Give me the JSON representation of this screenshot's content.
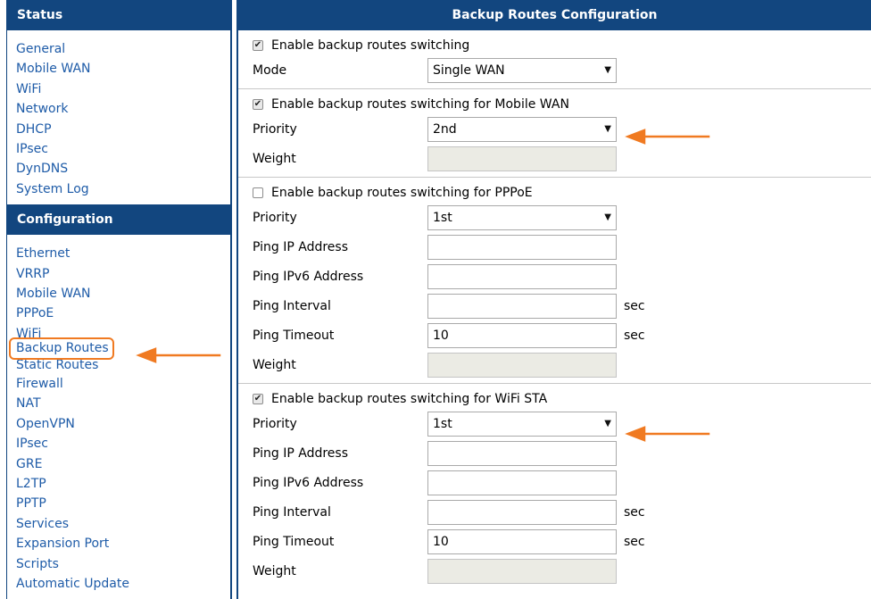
{
  "sidebar": {
    "status_title": "Status",
    "status_items": [
      "General",
      "Mobile WAN",
      "WiFi",
      "Network",
      "DHCP",
      "IPsec",
      "DynDNS",
      "System Log"
    ],
    "config_title": "Configuration",
    "config_items": [
      "Ethernet",
      "VRRP",
      "Mobile WAN",
      "PPPoE",
      "WiFi",
      "Backup Routes",
      "Static Routes",
      "Firewall",
      "NAT",
      "OpenVPN",
      "IPsec",
      "GRE",
      "L2TP",
      "PPTP",
      "Services",
      "Expansion Port",
      "Scripts",
      "Automatic Update"
    ],
    "active_item": "Backup Routes"
  },
  "main": {
    "title": "Backup Routes Configuration",
    "general": {
      "enable_label": "Enable backup routes switching",
      "enable_checked": true,
      "mode_label": "Mode",
      "mode_value": "Single WAN"
    },
    "mobile_wan": {
      "enable_label": "Enable backup routes switching for Mobile WAN",
      "enable_checked": true,
      "priority_label": "Priority",
      "priority_value": "2nd",
      "weight_label": "Weight",
      "weight_value": ""
    },
    "pppoe": {
      "enable_label": "Enable backup routes switching for PPPoE",
      "enable_checked": false,
      "priority_label": "Priority",
      "priority_value": "1st",
      "ping_ip_label": "Ping IP Address",
      "ping_ip_value": "",
      "ping_ipv6_label": "Ping IPv6 Address",
      "ping_ipv6_value": "",
      "ping_interval_label": "Ping Interval",
      "ping_interval_value": "",
      "ping_interval_unit": "sec",
      "ping_timeout_label": "Ping Timeout",
      "ping_timeout_value": "10",
      "ping_timeout_unit": "sec",
      "weight_label": "Weight",
      "weight_value": ""
    },
    "wifi_sta": {
      "enable_label": "Enable backup routes switching for WiFi STA",
      "enable_checked": true,
      "priority_label": "Priority",
      "priority_value": "1st",
      "ping_ip_label": "Ping IP Address",
      "ping_ip_value": "",
      "ping_ipv6_label": "Ping IPv6 Address",
      "ping_ipv6_value": "",
      "ping_interval_label": "Ping Interval",
      "ping_interval_value": "",
      "ping_interval_unit": "sec",
      "ping_timeout_label": "Ping Timeout",
      "ping_timeout_value": "10",
      "ping_timeout_unit": "sec",
      "weight_label": "Weight",
      "weight_value": ""
    }
  },
  "colors": {
    "header_bg": "#12467f",
    "link": "#1f5ca8",
    "highlight_arrow": "#f07a21",
    "disabled_field": "#ebebe4"
  }
}
